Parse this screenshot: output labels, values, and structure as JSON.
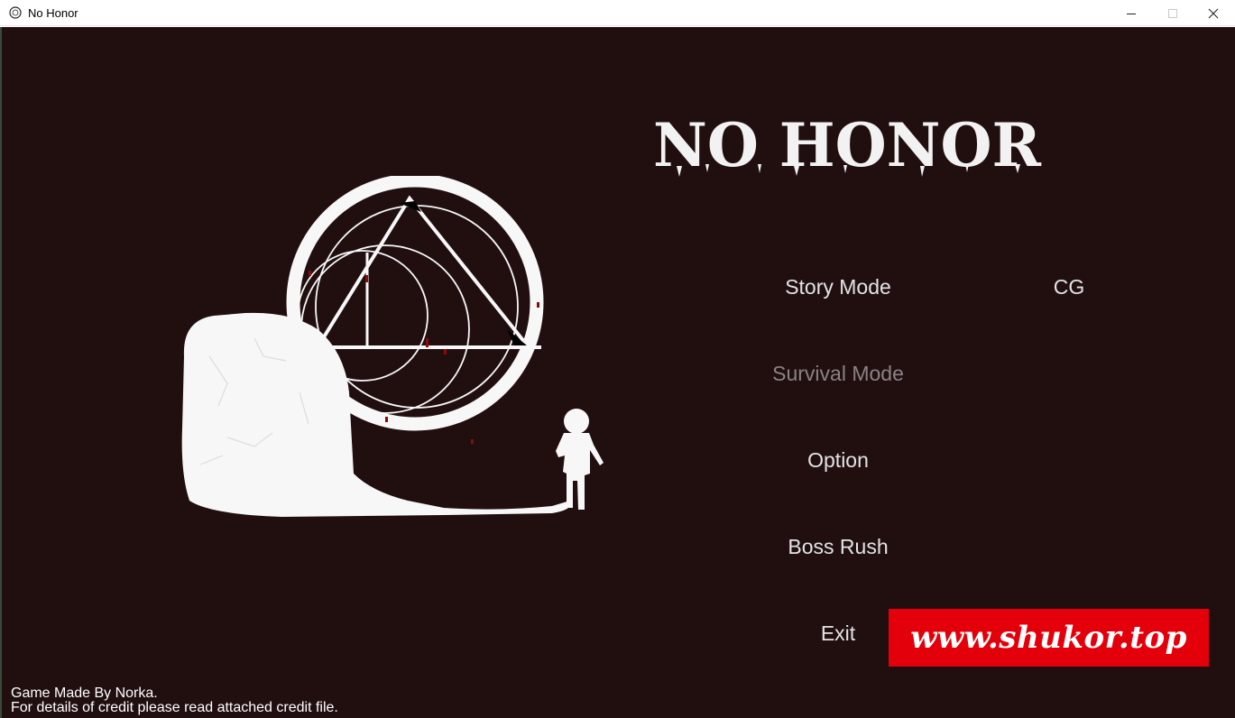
{
  "window": {
    "title": "No Honor",
    "icon": "game-logo-icon",
    "controls": [
      "minimize-icon",
      "maximize-icon",
      "close-icon"
    ]
  },
  "game": {
    "logo_text": "NO HONOR",
    "menu": {
      "story_mode": "Story Mode",
      "cg": "CG",
      "survival_mode": "Survival Mode",
      "option": "Option",
      "boss_rush": "Boss Rush",
      "exit": "Exit"
    },
    "credits": {
      "line1": "Game Made By Norka.",
      "line2": "For details of credit please read attached credit file."
    },
    "watermark": "www.shukor.top"
  },
  "colors": {
    "background": "#210f10",
    "menu_text": "#e3e3e3",
    "menu_disabled": "#8a8284",
    "watermark_bg": "#e3000b",
    "blood_accent": "#8b0a0a"
  }
}
